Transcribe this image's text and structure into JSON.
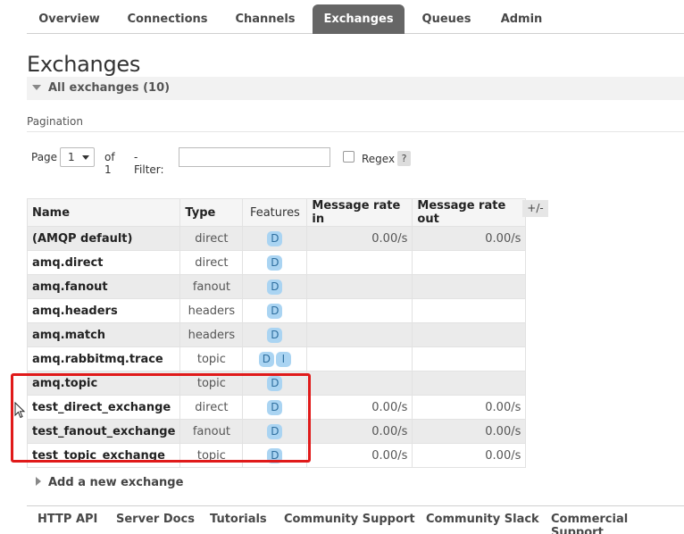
{
  "nav": {
    "tabs": [
      {
        "label": "Overview"
      },
      {
        "label": "Connections"
      },
      {
        "label": "Channels"
      },
      {
        "label": "Exchanges"
      },
      {
        "label": "Queues"
      },
      {
        "label": "Admin"
      }
    ],
    "active": "Exchanges"
  },
  "page": {
    "title": "Exchanges",
    "section_label": "All exchanges (10)"
  },
  "pagination": {
    "heading": "Pagination",
    "page_label": "Page",
    "page_value": "1",
    "of_label": "of 1",
    "filter_label": "- Filter:",
    "filter_value": "",
    "regex_label": "Regex",
    "help_label": "?"
  },
  "table": {
    "headers": [
      "Name",
      "Type",
      "Features",
      "Message rate in",
      "Message rate out"
    ],
    "toggle_label": "+/-",
    "rows": [
      {
        "name": "(AMQP default)",
        "type": "direct",
        "features": [
          "D"
        ],
        "rate_in": "0.00/s",
        "rate_out": "0.00/s"
      },
      {
        "name": "amq.direct",
        "type": "direct",
        "features": [
          "D"
        ],
        "rate_in": "",
        "rate_out": ""
      },
      {
        "name": "amq.fanout",
        "type": "fanout",
        "features": [
          "D"
        ],
        "rate_in": "",
        "rate_out": ""
      },
      {
        "name": "amq.headers",
        "type": "headers",
        "features": [
          "D"
        ],
        "rate_in": "",
        "rate_out": ""
      },
      {
        "name": "amq.match",
        "type": "headers",
        "features": [
          "D"
        ],
        "rate_in": "",
        "rate_out": ""
      },
      {
        "name": "amq.rabbitmq.trace",
        "type": "topic",
        "features": [
          "D",
          "I"
        ],
        "rate_in": "",
        "rate_out": ""
      },
      {
        "name": "amq.topic",
        "type": "topic",
        "features": [
          "D"
        ],
        "rate_in": "",
        "rate_out": ""
      },
      {
        "name": "test_direct_exchange",
        "type": "direct",
        "features": [
          "D"
        ],
        "rate_in": "0.00/s",
        "rate_out": "0.00/s"
      },
      {
        "name": "test_fanout_exchange",
        "type": "fanout",
        "features": [
          "D"
        ],
        "rate_in": "0.00/s",
        "rate_out": "0.00/s"
      },
      {
        "name": "test_topic_exchange",
        "type": "topic",
        "features": [
          "D"
        ],
        "rate_in": "0.00/s",
        "rate_out": "0.00/s"
      }
    ]
  },
  "add_exchange_label": "Add a new exchange",
  "footer": {
    "links": [
      "HTTP API",
      "Server Docs",
      "Tutorials",
      "Community Support",
      "Community Slack",
      "Commercial Support"
    ]
  },
  "colors": {
    "active_tab_bg": "#666666",
    "badge_bg": "#aad4f2",
    "highlight": "#e01a1a"
  }
}
